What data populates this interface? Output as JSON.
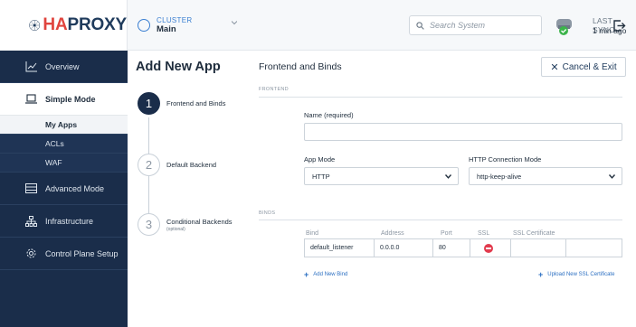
{
  "brand": {
    "prefix": "HA",
    "suffix": "PROXY"
  },
  "cluster": {
    "label": "CLUSTER",
    "name": "Main"
  },
  "search": {
    "placeholder": "Search System"
  },
  "sync": {
    "label": "LAST SYNC",
    "time": "1 min ago",
    "status_color": "#3cb44b"
  },
  "sidebar": {
    "items": [
      {
        "label": "Overview",
        "icon": "chart-line-icon"
      },
      {
        "label": "Simple Mode",
        "icon": "laptop-icon"
      },
      {
        "label": "Advanced Mode",
        "icon": "server-icon"
      },
      {
        "label": "Infrastructure",
        "icon": "sitemap-icon"
      },
      {
        "label": "Control Plane Setup",
        "icon": "gear-icon"
      }
    ],
    "subitems": [
      "My Apps",
      "ACLs",
      "WAF"
    ]
  },
  "page": {
    "title": "Add New App"
  },
  "steps": [
    {
      "number": "1",
      "label": "Frontend and Binds",
      "sub": ""
    },
    {
      "number": "2",
      "label": "Default Backend",
      "sub": ""
    },
    {
      "number": "3",
      "label": "Conditional Backends",
      "sub": "(optional)"
    }
  ],
  "panel": {
    "heading": "Frontend and Binds",
    "cancel_label": "Cancel & Exit",
    "frontend_section": "FRONTEND",
    "binds_section": "BINDS"
  },
  "form": {
    "name_label": "Name (required)",
    "name_value": "",
    "app_mode_label": "App Mode",
    "app_mode_value": "HTTP",
    "http_conn_label": "HTTP Connection Mode",
    "http_conn_value": "http-keep-alive"
  },
  "binds": {
    "columns": [
      "Bind",
      "Address",
      "Port",
      "SSL",
      "SSL Certificate"
    ],
    "rows": [
      {
        "bind": "default_listener",
        "address": "0.0.0.0",
        "port": "80",
        "ssl": false,
        "cert": ""
      }
    ],
    "add_bind_label": "Add New Bind",
    "upload_cert_label": "Upload New SSL Certificate"
  },
  "colors": {
    "sidebar": "#1a2d4a",
    "accent": "#2b6fc2",
    "brand_red": "#e0443e",
    "ssl_off": "#e23b4e"
  }
}
